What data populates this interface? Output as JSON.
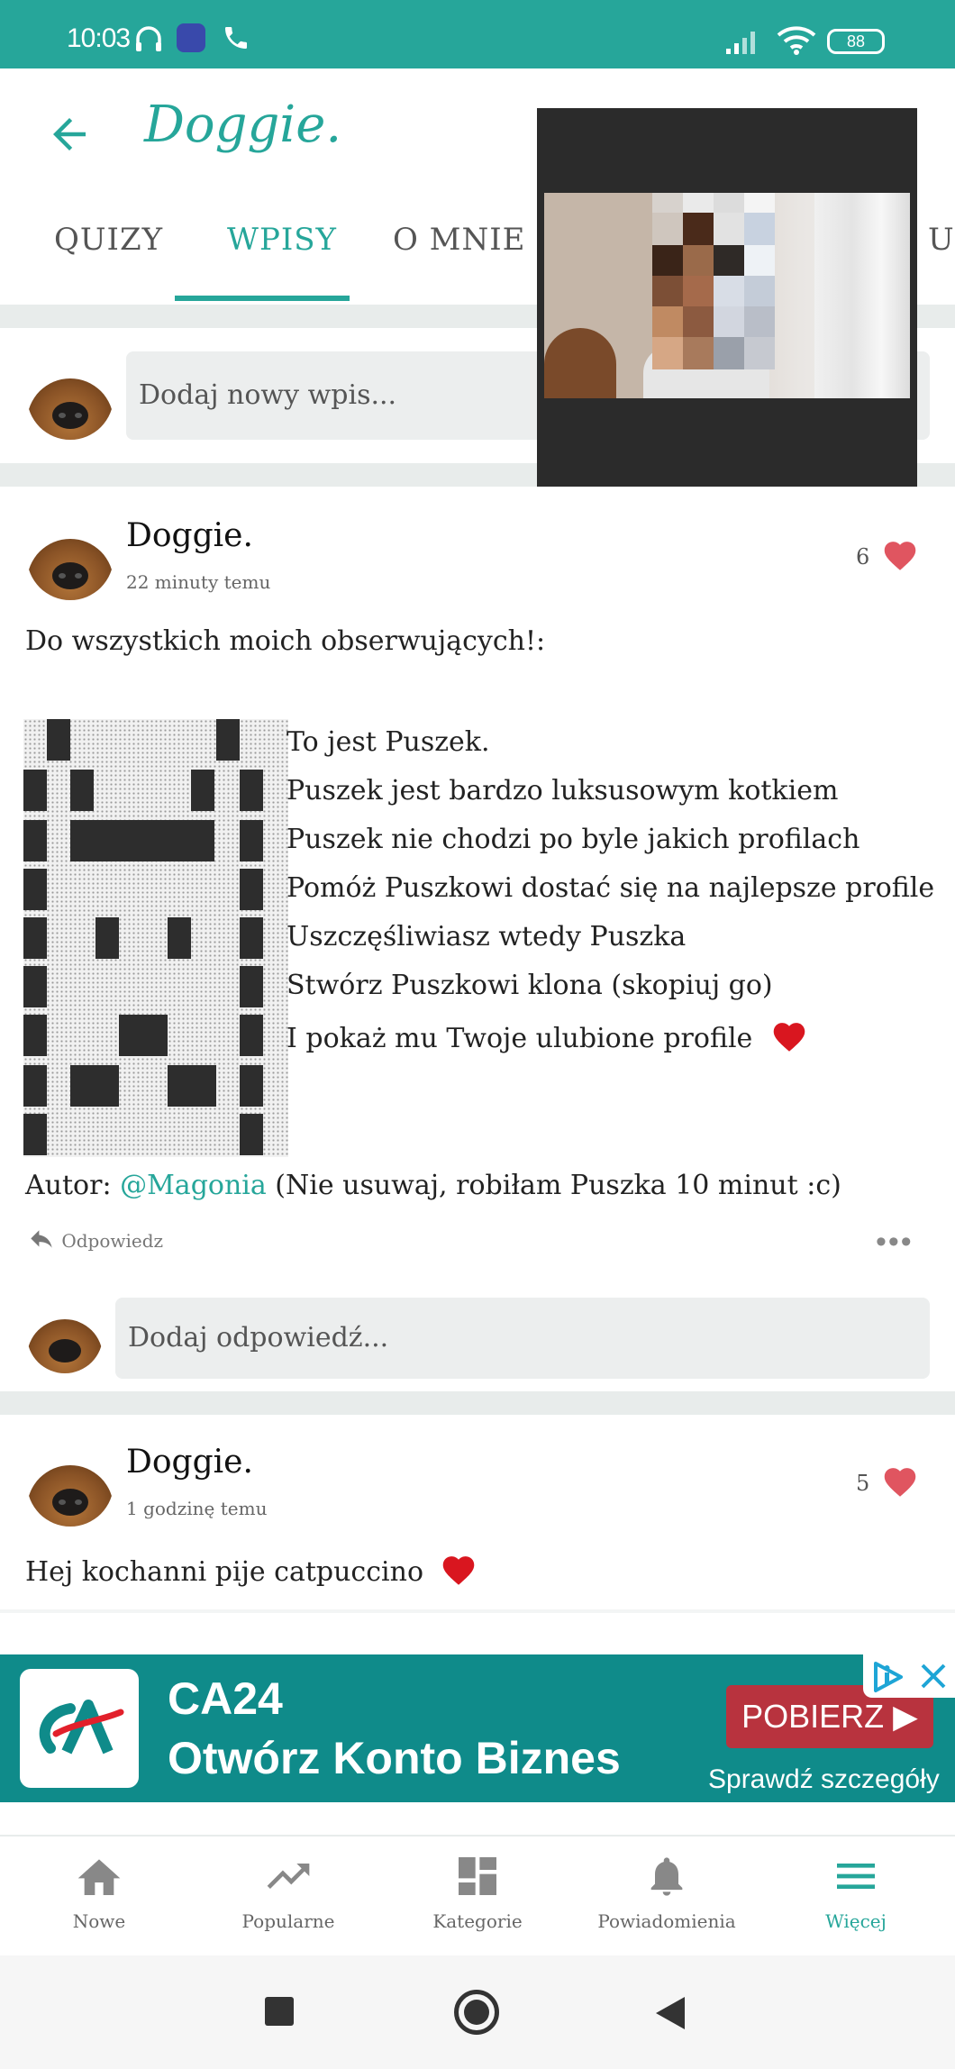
{
  "status_bar": {
    "time": "10:03",
    "battery": "88"
  },
  "header": {
    "title": "Doggie.",
    "tabs": [
      {
        "label": "QUIZY"
      },
      {
        "label": "WPISY",
        "active": true
      },
      {
        "label": "O MNIE"
      },
      {
        "label": "UL"
      }
    ]
  },
  "composer": {
    "placeholder": "Dodaj nowy wpis..."
  },
  "posts": [
    {
      "author": "Doggie.",
      "time": "22 minuty temu",
      "likes": "6",
      "intro": "Do wszystkich moich obserwujących!:",
      "poem": [
        "To jest Puszek.",
        "Puszek jest bardzo luksusowym kotkiem",
        "Puszek nie chodzi po byle jakich profilach",
        "Pomóż Puszkowi dostać się na najlepsze profile",
        "Uszczęśliwiasz wtedy Puszka",
        "Stwórz Puszkowi klona (skopiuj go)",
        "I pokaż mu Twoje ulubione profile"
      ],
      "credit_prefix": "Autor: ",
      "credit_mention": "@Magonia",
      "credit_suffix": " (Nie usuwaj, robiłam Puszka 10 minut :c)",
      "reply_label": "Odpowiedz",
      "reply_placeholder": "Dodaj odpowiedź..."
    },
    {
      "author": "Doggie.",
      "time": "1 godzinę temu",
      "likes": "5",
      "text": "Hej kochanni pije catpuccino"
    }
  ],
  "ad": {
    "title": "CA24",
    "subtitle": "Otwórz Konto Biznes",
    "button": "POBIERZ ▶",
    "note": "Sprawdź szczegóły"
  },
  "bottom_nav": [
    {
      "label": "Nowe",
      "icon": "home-icon"
    },
    {
      "label": "Popularne",
      "icon": "trending-icon"
    },
    {
      "label": "Kategorie",
      "icon": "categories-icon"
    },
    {
      "label": "Powiadomienia",
      "icon": "bell-icon"
    },
    {
      "label": "Więcej",
      "icon": "menu-icon",
      "active": true
    }
  ],
  "colors": {
    "accent": "#26a69a",
    "heart": "#e05560",
    "ad_bg": "#0f8b8a",
    "ad_button": "#b8333e"
  }
}
